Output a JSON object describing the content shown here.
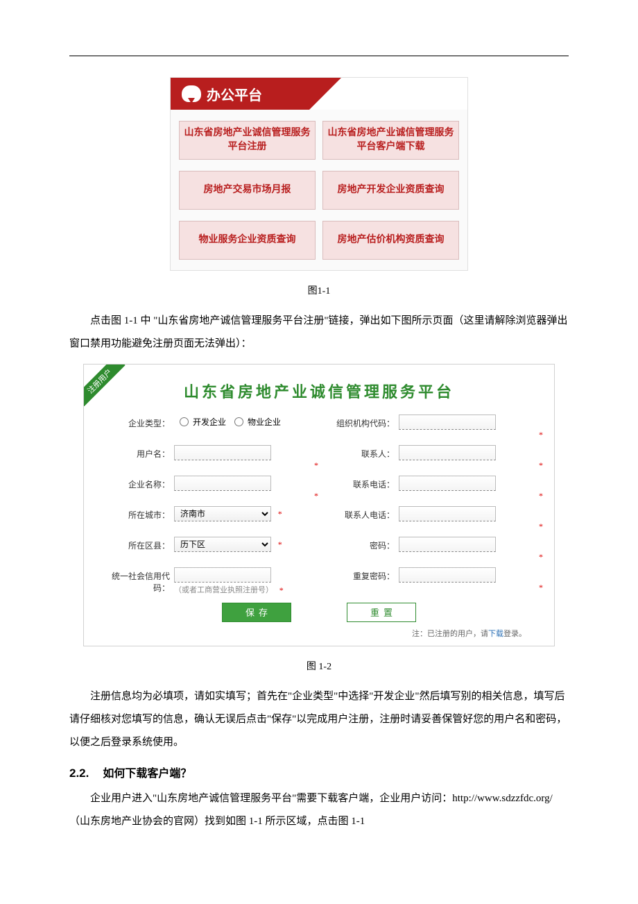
{
  "platform": {
    "header": "办公平台",
    "cells": [
      "山东省房地产业诚信管理服务平台注册",
      "山东省房地产业诚信管理服务平台客户端下载",
      "房地产交易市场月报",
      "房地产开发企业资质查询",
      "物业服务企业资质查询",
      "房地产估价机构资质查询"
    ]
  },
  "captions": {
    "fig1": "图1-1",
    "fig2": "图 1-2"
  },
  "paragraphs": {
    "p1": "点击图 1-1 中 \"山东省房地产诚信管理服务平台注册\"链接，弹出如下图所示页面（这里请解除浏览器弹出窗口禁用功能避免注册页面无法弹出）：",
    "p2": "注册信息均为必填项，请如实填写；首先在\"企业类型\"中选择\"开发企业\"然后填写别的相关信息，填写后请仔细核对您填写的信息，确认无误后点击\"保存\"以完成用户注册，注册时请妥善保管好您的用户名和密码，以便之后登录系统使用。",
    "p3": "企业用户进入\"山东房地产诚信管理服务平台\"需要下载客户端，企业用户访问：http://www.sdzzfdc.org/ （山东房地产业协会的官网）找到如图 1-1 所示区域，点击图 1-1"
  },
  "section": {
    "num": "2.2.",
    "title": "如何下载客户端？"
  },
  "form": {
    "ribbon": "注册用户",
    "title": "山东省房地产业诚信管理服务平台",
    "labels": {
      "enterprise_type": "企业类型：",
      "org_code": "组织机构代码：",
      "username": "用户名：",
      "contact": "联系人：",
      "company": "企业名称：",
      "phone": "联系电话：",
      "city": "所在城市：",
      "contact_phone": "联系人电话：",
      "district": "所在区县：",
      "password": "密码：",
      "credit_code": "统一社会信用代码：",
      "confirm_password": "重复密码："
    },
    "radios": {
      "dev": "开发企业",
      "prop": "物业企业"
    },
    "city_value": "济南市",
    "district_value": "历下区",
    "credit_hint": "（或者工商营业执照注册号）",
    "save_label": "保存",
    "reset_label": "重置",
    "note_prefix": "注：已注册的用户，请",
    "note_link": "下载",
    "note_suffix": "登录。"
  }
}
